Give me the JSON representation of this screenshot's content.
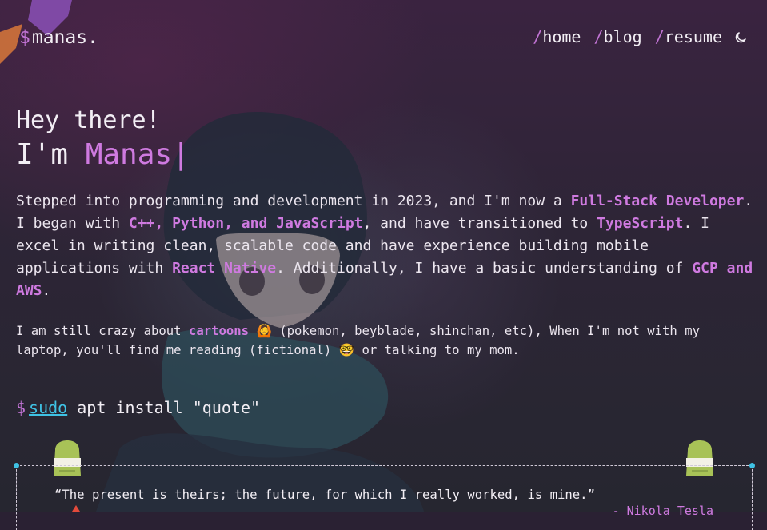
{
  "logo": {
    "prompt": "$",
    "name": "manas."
  },
  "nav": [
    {
      "slash": "/",
      "label": "home"
    },
    {
      "slash": "/",
      "label": "blog"
    },
    {
      "slash": "/",
      "label": "resume"
    }
  ],
  "theme_toggle": {
    "icon": "moon-icon"
  },
  "hero": {
    "greeting": "Hey there!",
    "iam_prefix": "I'm ",
    "name": "Manas",
    "cursor": "|"
  },
  "intro": {
    "p1_a": "Stepped into programming and development in 2023, and I'm now a ",
    "p1_role": "Full-Stack Developer",
    "p1_b": ". I began with ",
    "p1_langs": "C++, Python, and JavaScript",
    "p1_c": ", and have transitioned to ",
    "p1_ts": "TypeScript",
    "p1_d": ". I excel in writing clean, scalable code and have experience building mobile applications with ",
    "p1_rn": "React Native",
    "p1_e": ". Additionally, I have a basic understanding of ",
    "p1_cloud": "GCP and AWS",
    "p1_f": ".",
    "p2_a": "I am still crazy about ",
    "p2_cartoons": "cartoons",
    "p2_emoji1": "🙆",
    "p2_b": " (pokemon, beyblade, shinchan, etc), When I'm not with my laptop, you'll find me reading (fictional) ",
    "p2_emoji2": "🤓",
    "p2_c": " or talking to my mom."
  },
  "command": {
    "prompt": "$",
    "sudo": "sudo",
    "rest": " apt install \"quote\""
  },
  "quote": {
    "text": "“The present is theirs; the future, for which I really worked, is mine.”",
    "author": "- Nikola Tesla"
  },
  "colors": {
    "accent": "#cf7ae0",
    "link": "#3fc2e4",
    "underline": "#d08a2c",
    "background": "#2a2133"
  }
}
